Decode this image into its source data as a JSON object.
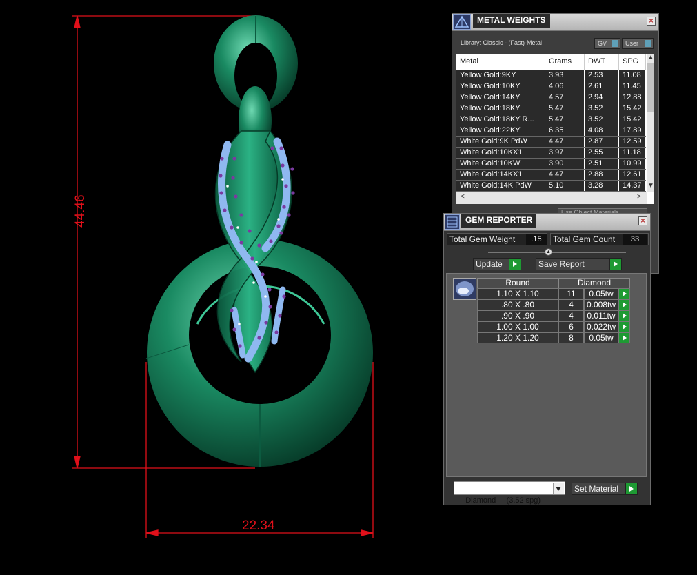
{
  "cad": {
    "dimension_height": "44.46",
    "dimension_width": "22.34",
    "colors": {
      "metal": "#1a8a62",
      "dimension": "#e0101a",
      "gem": "#8fb8f0",
      "prong": "#7a3aa0"
    }
  },
  "metal_weights": {
    "title": "METAL WEIGHTS",
    "library_label": "Library: Classic - (Fast)-Metal",
    "gv_label": "GV",
    "user_label": "User",
    "columns": [
      "Metal",
      "Grams",
      "DWT",
      "SPG"
    ],
    "rows": [
      {
        "metal": "Yellow Gold:9KY",
        "grams": "3.93",
        "dwt": "2.53",
        "spg": "11.08"
      },
      {
        "metal": "Yellow Gold:10KY",
        "grams": "4.06",
        "dwt": "2.61",
        "spg": "11.45"
      },
      {
        "metal": "Yellow Gold:14KY",
        "grams": "4.57",
        "dwt": "2.94",
        "spg": "12.88"
      },
      {
        "metal": "Yellow Gold:18KY",
        "grams": "5.47",
        "dwt": "3.52",
        "spg": "15.42"
      },
      {
        "metal": "Yellow Gold:18KY R...",
        "grams": "5.47",
        "dwt": "3.52",
        "spg": "15.42"
      },
      {
        "metal": "Yellow Gold:22KY",
        "grams": "6.35",
        "dwt": "4.08",
        "spg": "17.89"
      },
      {
        "metal": "White Gold:9K PdW",
        "grams": "4.47",
        "dwt": "2.87",
        "spg": "12.59"
      },
      {
        "metal": "White Gold:10KX1",
        "grams": "3.97",
        "dwt": "2.55",
        "spg": "11.18"
      },
      {
        "metal": "White Gold:10KW",
        "grams": "3.90",
        "dwt": "2.51",
        "spg": "10.99"
      },
      {
        "metal": "White Gold:14KX1",
        "grams": "4.47",
        "dwt": "2.88",
        "spg": "12.61"
      },
      {
        "metal": "White Gold:14K PdW",
        "grams": "5.10",
        "dwt": "3.28",
        "spg": "14.37"
      }
    ],
    "other_button": "Use Object Materials"
  },
  "gem_reporter": {
    "title": "GEM REPORTER",
    "total_weight_label": "Total Gem Weight",
    "total_weight_value": ".15",
    "total_count_label": "Total Gem Count",
    "total_count_value": "33",
    "update_label": "Update",
    "save_report_label": "Save Report",
    "shape_header": "Round",
    "material_header": "Diamond",
    "gems": [
      {
        "size": "1.10 X 1.10",
        "count": "11",
        "weight": "0.05tw"
      },
      {
        "size": ".80 X .80",
        "count": "4",
        "weight": "0.008tw"
      },
      {
        "size": ".90 X .90",
        "count": "4",
        "weight": "0.011tw"
      },
      {
        "size": "1.00 X 1.00",
        "count": "6",
        "weight": "0.022tw"
      },
      {
        "size": "1.20 X 1.20",
        "count": "8",
        "weight": "0.05tw"
      }
    ],
    "material_select": "Diamond     (3.52 spg)",
    "set_material_label": "Set Material"
  }
}
